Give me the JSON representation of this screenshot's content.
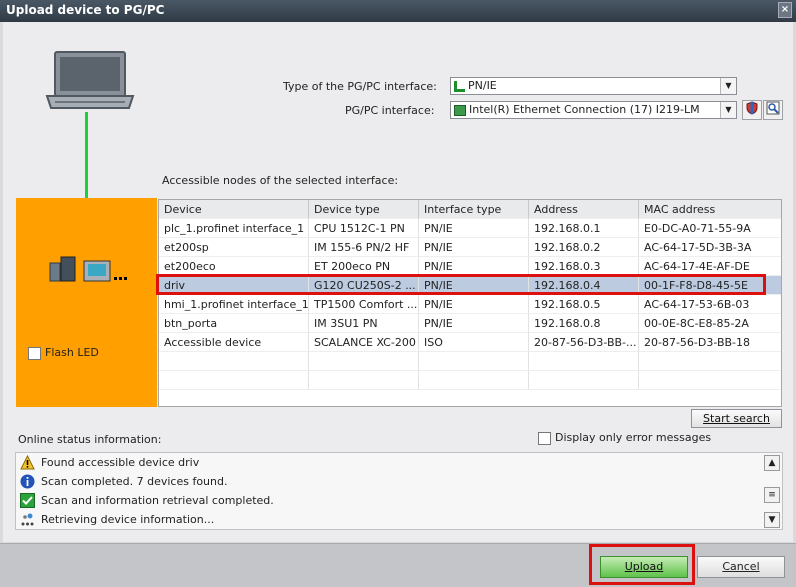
{
  "window": {
    "title": "Upload device to PG/PC",
    "close_label": "×"
  },
  "interface": {
    "type_label": "Type of the PG/PC interface:",
    "type_value": "PN/IE",
    "pgpc_label": "PG/PC interface:",
    "pgpc_value": "Intel(R) Ethernet Connection (17) I219-LM"
  },
  "nodes": {
    "heading": "Accessible nodes of the selected interface:",
    "columns": [
      "Device",
      "Device type",
      "Interface type",
      "Address",
      "MAC address"
    ],
    "rows": [
      [
        "plc_1.profinet interface_1",
        "CPU 1512C-1 PN",
        "PN/IE",
        "192.168.0.1",
        "E0-DC-A0-71-55-9A"
      ],
      [
        "et200sp",
        "IM 155-6 PN/2 HF",
        "PN/IE",
        "192.168.0.2",
        "AC-64-17-5D-3B-3A"
      ],
      [
        "et200eco",
        "ET 200eco PN",
        "PN/IE",
        "192.168.0.3",
        "AC-64-17-4E-AF-DE"
      ],
      [
        "driv",
        "G120 CU250S-2 ...",
        "PN/IE",
        "192.168.0.4",
        "00-1F-F8-D8-45-5E"
      ],
      [
        "hmi_1.profinet interface_1",
        "TP1500 Comfort ...",
        "PN/IE",
        "192.168.0.5",
        "AC-64-17-53-6B-03"
      ],
      [
        "btn_porta",
        "IM 3SU1 PN",
        "PN/IE",
        "192.168.0.8",
        "00-0E-8C-E8-85-2A"
      ],
      [
        "Accessible device",
        "SCALANCE XC-200",
        "ISO",
        "20-87-56-D3-BB-...",
        "20-87-56-D3-BB-18"
      ]
    ],
    "selected_row": 3
  },
  "flash_led_label": "Flash LED",
  "start_search_label": "Start search",
  "online_status": {
    "label": "Online status information:",
    "error_only_label": "Display only error messages",
    "messages": [
      {
        "icon": "warning-icon",
        "text": "Found accessible device driv"
      },
      {
        "icon": "info-icon",
        "text": "Scan completed. 7 devices found."
      },
      {
        "icon": "check-icon",
        "text": "Scan and information retrieval completed."
      },
      {
        "icon": "progress-icon",
        "text": "Retrieving device information..."
      }
    ]
  },
  "footer": {
    "upload_label": "Upload",
    "cancel_label": "Cancel"
  },
  "colors": {
    "orange_panel": "#FF9F00",
    "selection": "#BDCBE0",
    "highlight_red": "#DD1010",
    "upload_green": "#5FC24A"
  }
}
